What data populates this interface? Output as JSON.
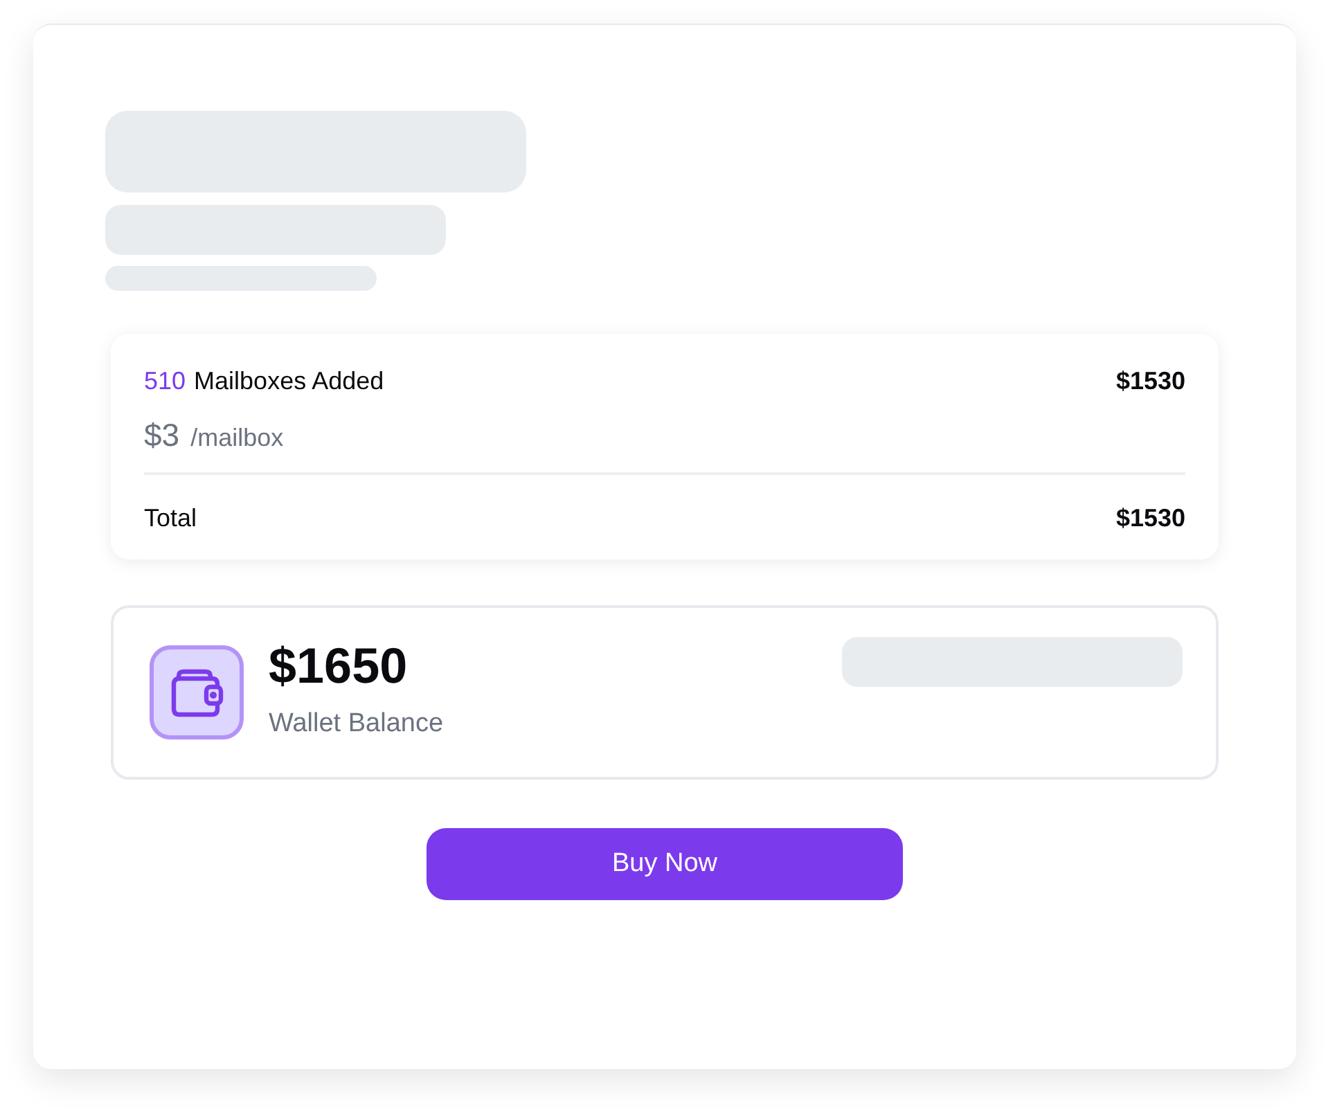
{
  "order_summary": {
    "line_item": {
      "quantity": "510",
      "label": "Mailboxes Added",
      "amount": "$1530"
    },
    "unit_price": {
      "price": "$3",
      "unit": "/mailbox"
    },
    "total": {
      "label": "Total",
      "amount": "$1530"
    }
  },
  "wallet": {
    "balance": "$1650",
    "label": "Wallet Balance"
  },
  "buy_button": {
    "label": "Buy Now"
  }
}
